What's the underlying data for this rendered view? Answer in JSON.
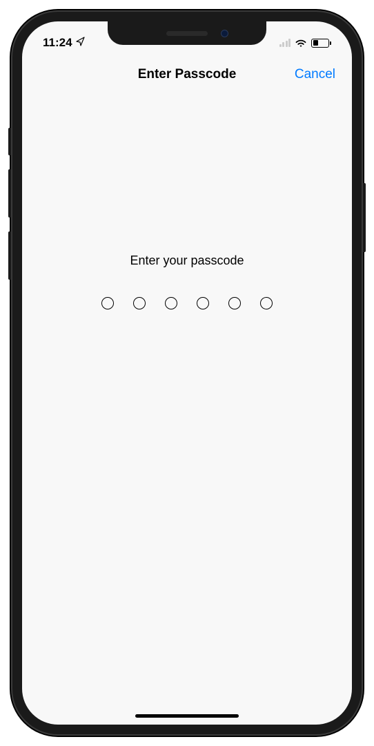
{
  "statusBar": {
    "time": "11:24"
  },
  "navBar": {
    "title": "Enter Passcode",
    "cancel": "Cancel"
  },
  "content": {
    "prompt": "Enter your passcode",
    "passcodeLength": 6,
    "filledDots": 0
  },
  "colors": {
    "accent": "#007AFF"
  }
}
